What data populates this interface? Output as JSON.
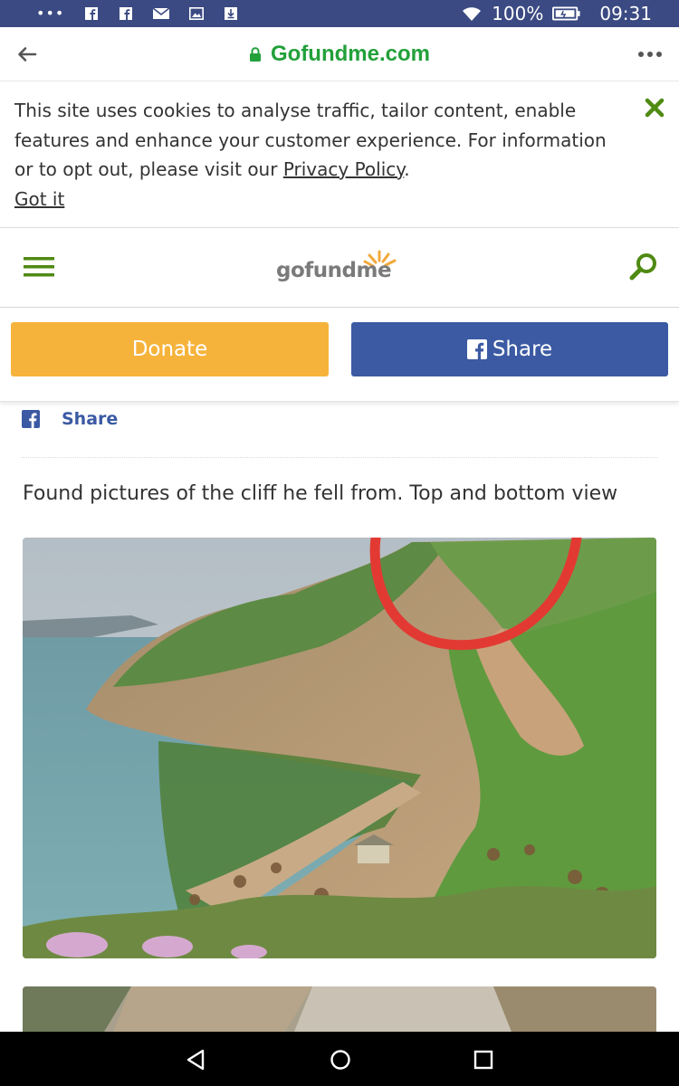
{
  "status_bar": {
    "battery": "100%",
    "time": "09:31",
    "icons": [
      "more-dots-icon",
      "facebook-notification-icon",
      "facebook-notification-icon",
      "mail-icon",
      "image-icon",
      "download-icon",
      "wifi-icon",
      "battery-icon"
    ]
  },
  "browser": {
    "url": "Gofundme.com",
    "back_icon": "arrow-left-icon",
    "more_icon": "more-dots-icon",
    "accent": "#22a03a"
  },
  "cookie_banner": {
    "text_before": "This site uses cookies to analyse traffic, tailor content, enable features and enhance your customer experience. For information or to opt out, please visit our ",
    "policy_link": "Privacy Policy",
    "text_after": ".",
    "got_it": "Got it"
  },
  "site_header": {
    "logo_text_a": "gofund",
    "logo_text_b": "me",
    "menu_icon": "hamburger-icon",
    "search_icon": "search-icon"
  },
  "actions": {
    "donate_label": "Donate",
    "share_label": "Share",
    "donate_color": "#f6b33b",
    "share_color": "#3b5aa3"
  },
  "post": {
    "share_link_label": "Share",
    "text": "Found pictures of the cliff he fell from. Top and bottom view"
  },
  "nav_bar": {
    "icons": [
      "nav-back-icon",
      "nav-home-icon",
      "nav-recent-apps-icon"
    ]
  }
}
